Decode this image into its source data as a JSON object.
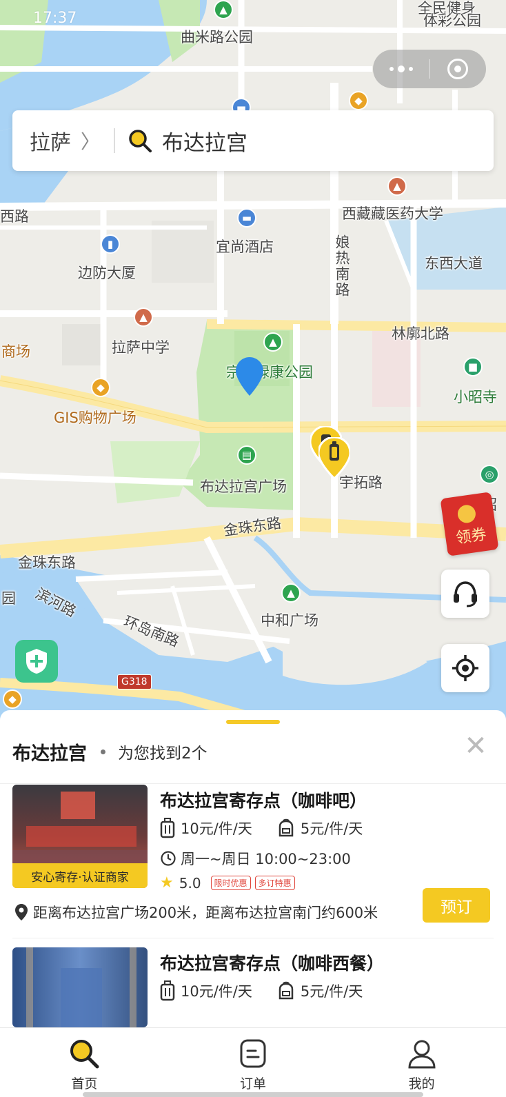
{
  "status_bar": {
    "time": "17:37"
  },
  "capsule": {
    "menu_icon": "more-dots-icon",
    "close_icon": "target-circle-icon"
  },
  "search": {
    "city": "拉萨",
    "query": "布达拉宫"
  },
  "map": {
    "labels": {
      "qumi_park": "曲米路公园",
      "quanmin_park": "全民健身",
      "ticai_park": "体彩公园",
      "xi_road": "西路",
      "tibet_medical_univ": "西藏藏医药大学",
      "yishang_hotel": "宜尚酒店",
      "niangre_road": "娘热南路",
      "dongxi_avenue": "东西大道",
      "bianfang_building": "边防大厦",
      "linkuo_north_road": "林廓北路",
      "mall": "商场",
      "lhasa_middle_school": "拉萨中学",
      "zongjiao_park": "宗角禄康公园",
      "xiaozhao_temple": "小昭寺",
      "gis_plaza": "GIS购物广场",
      "potala_square": "布达拉宫广场",
      "yutuo_road": "宇拓路",
      "jinzhu_east_road_1": "金珠东路",
      "jinzhu_east_road_2": "金珠东路",
      "binhe_road": "滨河路",
      "huandao_south_road": "环岛南路",
      "zhonghe_square": "中和广场",
      "g318": "G318",
      "yuan": "园",
      "zhao": "昭"
    },
    "coupon_label": "领券",
    "buttons": {
      "service_icon": "headset-icon",
      "locate_icon": "locate-crosshair-icon",
      "shield_icon": "shield-plus-icon"
    }
  },
  "result_sheet": {
    "title": "布达拉宫",
    "subtitle": "为您找到2个",
    "stores": [
      {
        "name": "布达拉宫寄存点（咖啡吧）",
        "price_luggage": "10元/件/天",
        "price_bag": "5元/件/天",
        "hours": "周一~周日 10:00~23:00",
        "rating": "5.0",
        "tags": [
          "限时优惠",
          "多订特惠"
        ],
        "badge": "安心寄存·认证商家",
        "distance": "距离布达拉宫广场200米，距离布达拉宫南门约600米",
        "book_label": "预订"
      },
      {
        "name": "布达拉宫寄存点（咖啡西餐）",
        "price_luggage": "10元/件/天",
        "price_bag": "5元/件/天"
      }
    ]
  },
  "tabbar": {
    "tabs": [
      {
        "label": "首页",
        "icon": "search-icon"
      },
      {
        "label": "订单",
        "icon": "order-icon"
      },
      {
        "label": "我的",
        "icon": "user-icon"
      }
    ]
  },
  "colors": {
    "accent": "#f4c922",
    "water": "#a9d3f5",
    "park": "#c6e8b4",
    "road_major": "#fce9a3",
    "pin_blue": "#2c8ae8"
  }
}
